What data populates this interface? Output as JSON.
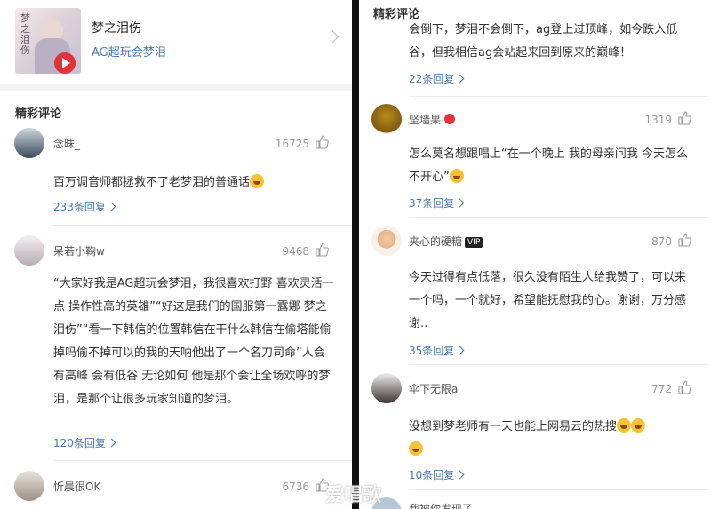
{
  "song": {
    "title": "梦之泪伤",
    "artist": "AG超玩会梦泪",
    "cover_text": "梦之泪伤"
  },
  "left": {
    "section_title": "精彩评论",
    "comments": [
      {
        "user": "念昧_",
        "likes": "16725",
        "text": "百万调音师都拯救不了老梦泪的普通话",
        "replies": "233条回复"
      },
      {
        "user": "呆若小鞠w",
        "likes": "9468",
        "text": "“大家好我是AG超玩会梦泪，我很喜欢打野 喜欢灵活一点 操作性高的英雄”“好这是我们的国服第一露娜 梦之泪伤”“看一下韩信的位置韩信在干什么韩信在偷塔能偷掉吗偷不掉可以的我的天呐他出了一个名刀司命”人会有高峰 会有低谷 无论如何 他是那个会让全场欢呼的梦泪，是那个让很多玩家知道的梦泪。",
        "replies": "120条回复"
      },
      {
        "user": "忻晨很OK",
        "likes": "6736"
      }
    ]
  },
  "right": {
    "section_title": "精彩评论",
    "top_text": "会倒下，梦泪不会倒下，ag登上过顶峰，如今跌入低谷，但我相信ag会站起来回到原来的巅峰！",
    "top_replies": "22条回复",
    "comments": [
      {
        "user": "坚墙果",
        "likes": "1319",
        "text": "怎么莫名想跟唱上“在一个晚上 我的母亲问我 今天怎么不开心”",
        "replies": "37条回复"
      },
      {
        "user": "夹心的硬糖",
        "badge": "VIP",
        "likes": "870",
        "text": "今天过得有点低落，很久没有陌生人给我赞了，可以来一个吗，一个就好，希望能抚慰我的心。谢谢，万分感谢..",
        "replies": "35条回复"
      },
      {
        "user": "伞下无限a",
        "likes": "772",
        "text": "没想到梦老师有一天也能上网易云的热搜",
        "replies": "10条回复"
      },
      {
        "user": "我被你发现了"
      }
    ]
  },
  "watermark": "爱唱歌"
}
